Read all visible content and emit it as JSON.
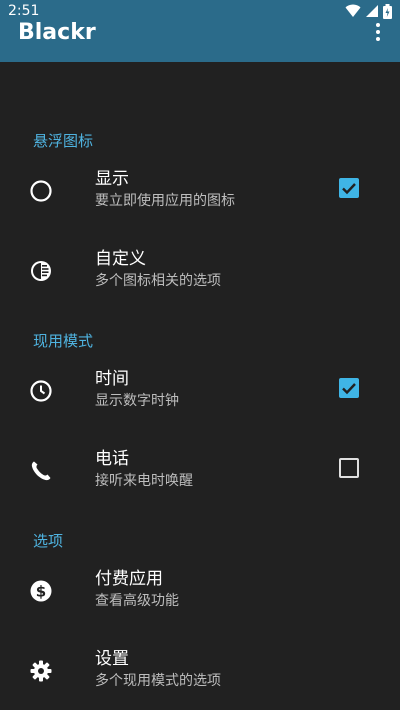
{
  "status_bar": {
    "time": "2:51",
    "icons": [
      "wifi-icon",
      "signal-icon",
      "battery-icon"
    ]
  },
  "app_bar": {
    "title": "Blackr",
    "menu_icon": "overflow-menu-icon"
  },
  "sections": [
    {
      "header": "悬浮图标",
      "items": [
        {
          "icon": "circle-icon",
          "title": "显示",
          "summary": "要立即使用应用的图标",
          "checkbox": true
        },
        {
          "icon": "contrast-icon",
          "title": "自定义",
          "summary": "多个图标相关的选项",
          "checkbox": null
        }
      ]
    },
    {
      "header": "现用模式",
      "items": [
        {
          "icon": "clock-icon",
          "title": "时间",
          "summary": "显示数字时钟",
          "checkbox": true
        },
        {
          "icon": "phone-icon",
          "title": "电话",
          "summary": "接听来电时唤醒",
          "checkbox": false
        }
      ]
    },
    {
      "header": "选项",
      "items": [
        {
          "icon": "dollar-icon",
          "title": "付费应用",
          "summary": "查看高级功能",
          "checkbox": null
        },
        {
          "icon": "gear-icon",
          "title": "设置",
          "summary": "多个现用模式的选项",
          "checkbox": null
        }
      ]
    }
  ],
  "colors": {
    "app_bar": "#2b6b8a",
    "background": "#212121",
    "accent": "#4fb3e0",
    "checkbox_checked": "#3fb5e6"
  }
}
